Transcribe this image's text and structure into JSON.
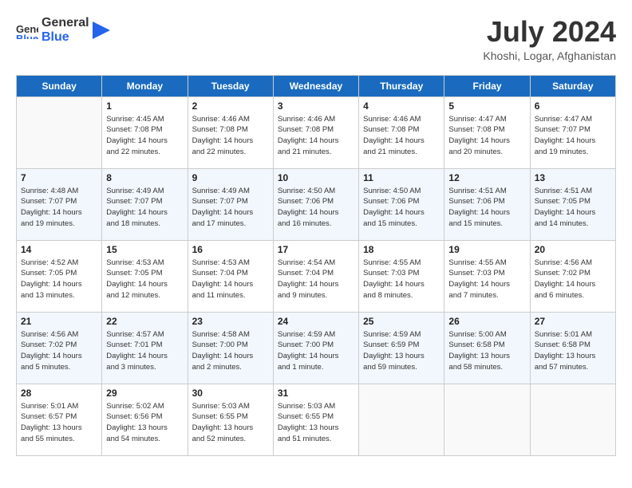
{
  "header": {
    "logo_general": "General",
    "logo_blue": "Blue",
    "month_year": "July 2024",
    "location": "Khoshi, Logar, Afghanistan"
  },
  "weekdays": [
    "Sunday",
    "Monday",
    "Tuesday",
    "Wednesday",
    "Thursday",
    "Friday",
    "Saturday"
  ],
  "weeks": [
    [
      {
        "day": "",
        "info": ""
      },
      {
        "day": "1",
        "info": "Sunrise: 4:45 AM\nSunset: 7:08 PM\nDaylight: 14 hours\nand 22 minutes."
      },
      {
        "day": "2",
        "info": "Sunrise: 4:46 AM\nSunset: 7:08 PM\nDaylight: 14 hours\nand 22 minutes."
      },
      {
        "day": "3",
        "info": "Sunrise: 4:46 AM\nSunset: 7:08 PM\nDaylight: 14 hours\nand 21 minutes."
      },
      {
        "day": "4",
        "info": "Sunrise: 4:46 AM\nSunset: 7:08 PM\nDaylight: 14 hours\nand 21 minutes."
      },
      {
        "day": "5",
        "info": "Sunrise: 4:47 AM\nSunset: 7:08 PM\nDaylight: 14 hours\nand 20 minutes."
      },
      {
        "day": "6",
        "info": "Sunrise: 4:47 AM\nSunset: 7:07 PM\nDaylight: 14 hours\nand 19 minutes."
      }
    ],
    [
      {
        "day": "7",
        "info": "Sunrise: 4:48 AM\nSunset: 7:07 PM\nDaylight: 14 hours\nand 19 minutes."
      },
      {
        "day": "8",
        "info": "Sunrise: 4:49 AM\nSunset: 7:07 PM\nDaylight: 14 hours\nand 18 minutes."
      },
      {
        "day": "9",
        "info": "Sunrise: 4:49 AM\nSunset: 7:07 PM\nDaylight: 14 hours\nand 17 minutes."
      },
      {
        "day": "10",
        "info": "Sunrise: 4:50 AM\nSunset: 7:06 PM\nDaylight: 14 hours\nand 16 minutes."
      },
      {
        "day": "11",
        "info": "Sunrise: 4:50 AM\nSunset: 7:06 PM\nDaylight: 14 hours\nand 15 minutes."
      },
      {
        "day": "12",
        "info": "Sunrise: 4:51 AM\nSunset: 7:06 PM\nDaylight: 14 hours\nand 15 minutes."
      },
      {
        "day": "13",
        "info": "Sunrise: 4:51 AM\nSunset: 7:05 PM\nDaylight: 14 hours\nand 14 minutes."
      }
    ],
    [
      {
        "day": "14",
        "info": "Sunrise: 4:52 AM\nSunset: 7:05 PM\nDaylight: 14 hours\nand 13 minutes."
      },
      {
        "day": "15",
        "info": "Sunrise: 4:53 AM\nSunset: 7:05 PM\nDaylight: 14 hours\nand 12 minutes."
      },
      {
        "day": "16",
        "info": "Sunrise: 4:53 AM\nSunset: 7:04 PM\nDaylight: 14 hours\nand 11 minutes."
      },
      {
        "day": "17",
        "info": "Sunrise: 4:54 AM\nSunset: 7:04 PM\nDaylight: 14 hours\nand 9 minutes."
      },
      {
        "day": "18",
        "info": "Sunrise: 4:55 AM\nSunset: 7:03 PM\nDaylight: 14 hours\nand 8 minutes."
      },
      {
        "day": "19",
        "info": "Sunrise: 4:55 AM\nSunset: 7:03 PM\nDaylight: 14 hours\nand 7 minutes."
      },
      {
        "day": "20",
        "info": "Sunrise: 4:56 AM\nSunset: 7:02 PM\nDaylight: 14 hours\nand 6 minutes."
      }
    ],
    [
      {
        "day": "21",
        "info": "Sunrise: 4:56 AM\nSunset: 7:02 PM\nDaylight: 14 hours\nand 5 minutes."
      },
      {
        "day": "22",
        "info": "Sunrise: 4:57 AM\nSunset: 7:01 PM\nDaylight: 14 hours\nand 3 minutes."
      },
      {
        "day": "23",
        "info": "Sunrise: 4:58 AM\nSunset: 7:00 PM\nDaylight: 14 hours\nand 2 minutes."
      },
      {
        "day": "24",
        "info": "Sunrise: 4:59 AM\nSunset: 7:00 PM\nDaylight: 14 hours\nand 1 minute."
      },
      {
        "day": "25",
        "info": "Sunrise: 4:59 AM\nSunset: 6:59 PM\nDaylight: 13 hours\nand 59 minutes."
      },
      {
        "day": "26",
        "info": "Sunrise: 5:00 AM\nSunset: 6:58 PM\nDaylight: 13 hours\nand 58 minutes."
      },
      {
        "day": "27",
        "info": "Sunrise: 5:01 AM\nSunset: 6:58 PM\nDaylight: 13 hours\nand 57 minutes."
      }
    ],
    [
      {
        "day": "28",
        "info": "Sunrise: 5:01 AM\nSunset: 6:57 PM\nDaylight: 13 hours\nand 55 minutes."
      },
      {
        "day": "29",
        "info": "Sunrise: 5:02 AM\nSunset: 6:56 PM\nDaylight: 13 hours\nand 54 minutes."
      },
      {
        "day": "30",
        "info": "Sunrise: 5:03 AM\nSunset: 6:55 PM\nDaylight: 13 hours\nand 52 minutes."
      },
      {
        "day": "31",
        "info": "Sunrise: 5:03 AM\nSunset: 6:55 PM\nDaylight: 13 hours\nand 51 minutes."
      },
      {
        "day": "",
        "info": ""
      },
      {
        "day": "",
        "info": ""
      },
      {
        "day": "",
        "info": ""
      }
    ]
  ]
}
